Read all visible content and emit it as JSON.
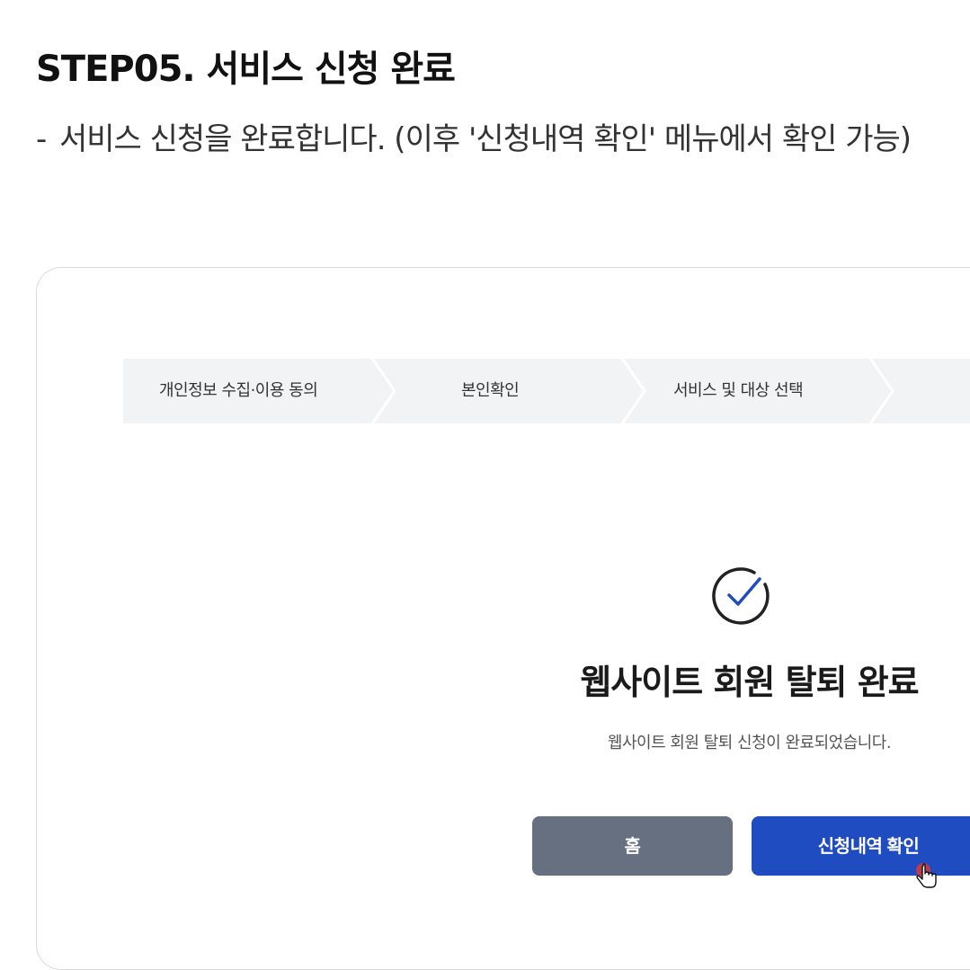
{
  "header": {
    "title": "STEP05. 서비스 신청 완료",
    "description_bullet": "-",
    "description": "서비스 신청을 완료합니다. (이후 '신청내역 확인' 메뉴에서 확인 가능)"
  },
  "screenshot": {
    "stepper": {
      "steps": [
        {
          "label": "개인정보 수집·이용 동의"
        },
        {
          "label": "본인확인"
        },
        {
          "label": "서비스 및 대상 선택"
        }
      ]
    },
    "completion": {
      "icon": "check-circle-icon",
      "title": "웹사이트 회원 탈퇴 완료",
      "message": "웹사이트 회원 탈퇴 신청이 완료되었습니다."
    },
    "buttons": {
      "home_label": "홈",
      "history_label": "신청내역 확인"
    }
  },
  "colors": {
    "primary": "#1f4cc1",
    "secondary_button": "#667080",
    "stepper_bg": "#f2f3f5",
    "cursor_dot": "#d9383a"
  }
}
